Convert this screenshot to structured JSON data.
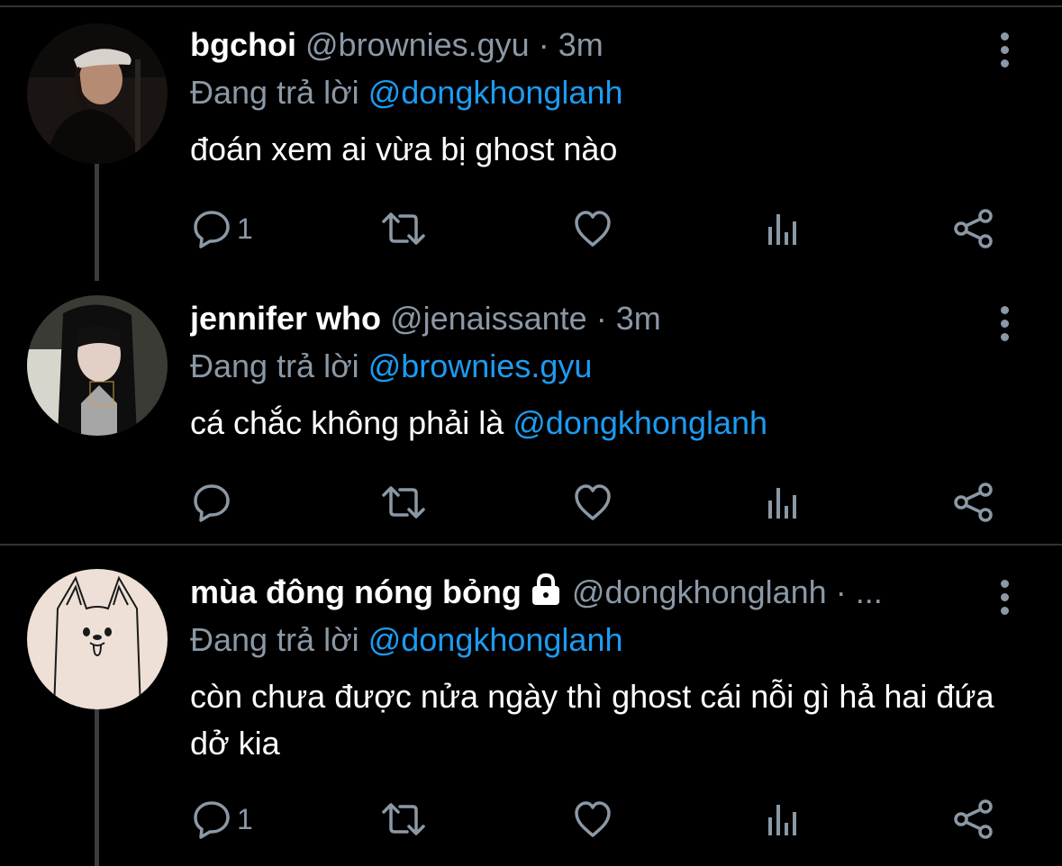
{
  "tweets": [
    {
      "name": "bgchoi",
      "handle": "@brownies.gyu",
      "dot": "·",
      "time": "3m",
      "reply_prefix": "Đang trả lời",
      "reply_to": "@dongkhonglanh",
      "body_plain": "đoán xem ai vừa bị ghost nào",
      "body_mention": "",
      "replies": "1"
    },
    {
      "name": "jennifer who",
      "handle": "@jenaissante",
      "dot": "·",
      "time": "3m",
      "reply_prefix": "Đang trả lời",
      "reply_to": "@brownies.gyu",
      "body_plain": "cá chắc không phải là ",
      "body_mention": "@dongkhonglanh",
      "replies": ""
    },
    {
      "name": "mùa đông nóng bỏng",
      "handle": "@dongkhonglanh",
      "dot": "·",
      "time": "...",
      "reply_prefix": "Đang trả lời",
      "reply_to": "@dongkhonglanh",
      "body_plain": "còn chưa được nửa ngày thì ghost cái nỗi gì hả hai đứa dở kia",
      "body_mention": "",
      "replies": "1"
    }
  ],
  "colors": {
    "background": "#000000",
    "text": "#ffffff",
    "secondary": "#8b98a5",
    "mention": "#1d9bf0",
    "divider": "#2f3336"
  },
  "icons": [
    "reply-icon",
    "retweet-icon",
    "like-icon",
    "analytics-icon",
    "share-icon",
    "more-icon",
    "lock-icon"
  ]
}
